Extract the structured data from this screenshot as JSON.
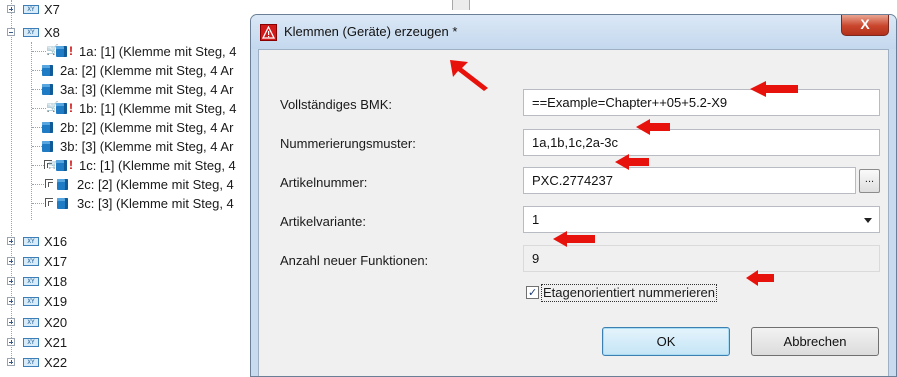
{
  "tree": {
    "nodes": [
      {
        "label": "X7"
      },
      {
        "label": "X8"
      },
      {
        "label": "1a: [1] (Klemme mit Steg, 4"
      },
      {
        "label": "2a: [2] (Klemme mit Steg, 4 Ar"
      },
      {
        "label": "3a: [3] (Klemme mit Steg, 4 Ar"
      },
      {
        "label": "1b: [1] (Klemme mit Steg, 4"
      },
      {
        "label": "2b: [2] (Klemme mit Steg, 4 Ar"
      },
      {
        "label": "3b: [3] (Klemme mit Steg, 4 Ar"
      },
      {
        "label": "1c: [1] (Klemme mit Steg, 4"
      },
      {
        "label": "2c: [2] (Klemme mit Steg, 4"
      },
      {
        "label": "3c: [3] (Klemme mit Steg, 4"
      },
      {
        "label": "X16"
      },
      {
        "label": "X17"
      },
      {
        "label": "X18"
      },
      {
        "label": "X19"
      },
      {
        "label": "X20"
      },
      {
        "label": "X21"
      },
      {
        "label": "X22"
      }
    ],
    "xy_icon_text": "XY",
    "warning_mark": "!"
  },
  "dialog": {
    "title": "Klemmen (Geräte) erzeugen *",
    "close_label": "X",
    "fields": {
      "bmk": {
        "label": "Vollständiges BMK:",
        "value": "==Example=Chapter++05+5.2-X9"
      },
      "pattern": {
        "label": "Nummerierungsmuster:",
        "value": "1a,1b,1c,2a-3c"
      },
      "article": {
        "label": "Artikelnummer:",
        "value": "PXC.2774237",
        "browse_label": "..."
      },
      "variant": {
        "label": "Artikelvariante:",
        "value": "1"
      },
      "count": {
        "label": "Anzahl neuer Funktionen:",
        "value": "9"
      }
    },
    "checkbox": {
      "label": "Etagenorientiert nummerieren",
      "checked": true,
      "mark": "✓"
    },
    "ok_label": "OK",
    "cancel_label": "Abbrechen"
  },
  "colors": {
    "annotation_arrow": "#e8120c",
    "title_icon": "#d11a1a",
    "close_button": "#c9452c"
  }
}
